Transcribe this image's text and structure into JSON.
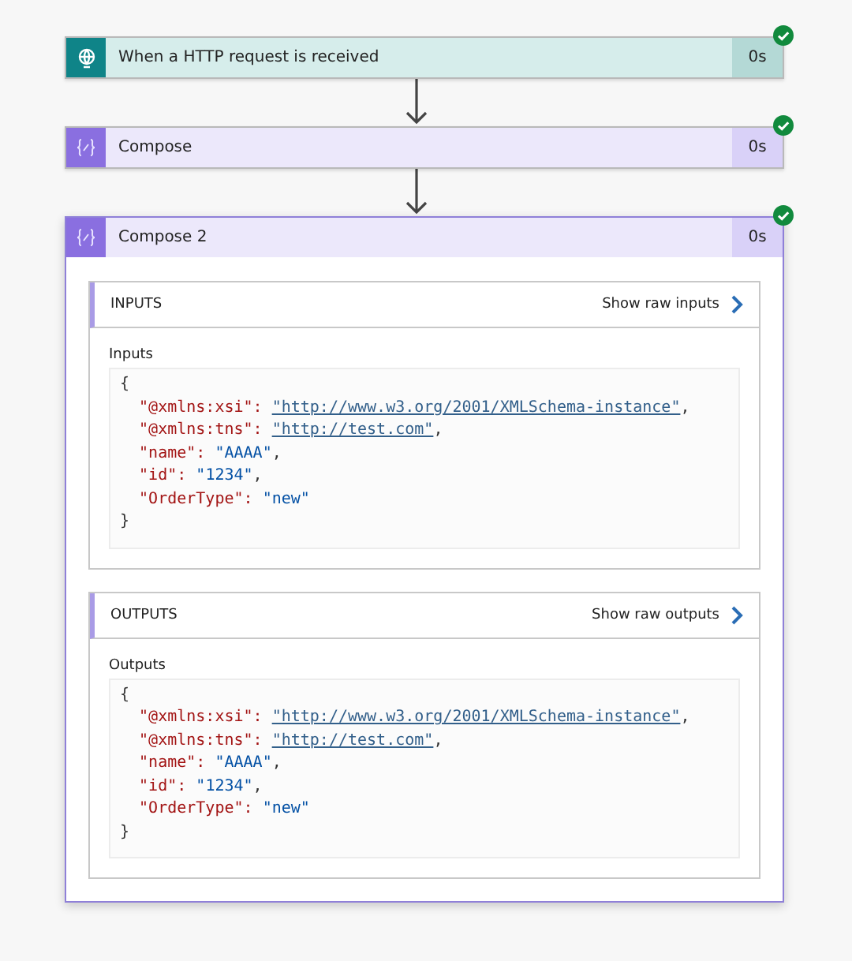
{
  "steps": [
    {
      "kind": "trigger",
      "title": "When a HTTP request is received",
      "duration": "0s",
      "succeeded": true,
      "expanded": false
    },
    {
      "kind": "compose",
      "title": "Compose",
      "duration": "0s",
      "succeeded": true,
      "expanded": false
    },
    {
      "kind": "compose",
      "title": "Compose 2",
      "duration": "0s",
      "succeeded": true,
      "expanded": true,
      "sections": [
        {
          "heading": "INPUTS",
          "link": "Show raw inputs",
          "label": "Inputs",
          "lines": [
            [
              {
                "kind": "punct",
                "text": "{"
              }
            ],
            [
              {
                "kind": "key",
                "text": "  \"@xmlns:xsi\": "
              },
              {
                "kind": "link",
                "text": "\"http://www.w3.org/2001/XMLSchema-instance\""
              },
              {
                "kind": "punct",
                "text": ","
              }
            ],
            [
              {
                "kind": "key",
                "text": "  \"@xmlns:tns\": "
              },
              {
                "kind": "link",
                "text": "\"http://test.com\""
              },
              {
                "kind": "punct",
                "text": ","
              }
            ],
            [
              {
                "kind": "key",
                "text": "  \"name\": "
              },
              {
                "kind": "string",
                "text": "\"AAAA\""
              },
              {
                "kind": "punct",
                "text": ","
              }
            ],
            [
              {
                "kind": "key",
                "text": "  \"id\": "
              },
              {
                "kind": "string",
                "text": "\"1234\""
              },
              {
                "kind": "punct",
                "text": ","
              }
            ],
            [
              {
                "kind": "key",
                "text": "  \"OrderType\": "
              },
              {
                "kind": "string",
                "text": "\"new\""
              }
            ],
            [
              {
                "kind": "punct",
                "text": "}"
              }
            ]
          ]
        },
        {
          "heading": "OUTPUTS",
          "link": "Show raw outputs",
          "label": "Outputs",
          "lines": [
            [
              {
                "kind": "punct",
                "text": "{"
              }
            ],
            [
              {
                "kind": "key",
                "text": "  \"@xmlns:xsi\": "
              },
              {
                "kind": "link",
                "text": "\"http://www.w3.org/2001/XMLSchema-instance\""
              },
              {
                "kind": "punct",
                "text": ","
              }
            ],
            [
              {
                "kind": "key",
                "text": "  \"@xmlns:tns\": "
              },
              {
                "kind": "link",
                "text": "\"http://test.com\""
              },
              {
                "kind": "punct",
                "text": ","
              }
            ],
            [
              {
                "kind": "key",
                "text": "  \"name\": "
              },
              {
                "kind": "string",
                "text": "\"AAAA\""
              },
              {
                "kind": "punct",
                "text": ","
              }
            ],
            [
              {
                "kind": "key",
                "text": "  \"id\": "
              },
              {
                "kind": "string",
                "text": "\"1234\""
              },
              {
                "kind": "punct",
                "text": ","
              }
            ],
            [
              {
                "kind": "key",
                "text": "  \"OrderType\": "
              },
              {
                "kind": "string",
                "text": "\"new\""
              }
            ],
            [
              {
                "kind": "punct",
                "text": "}"
              }
            ]
          ]
        }
      ]
    }
  ]
}
